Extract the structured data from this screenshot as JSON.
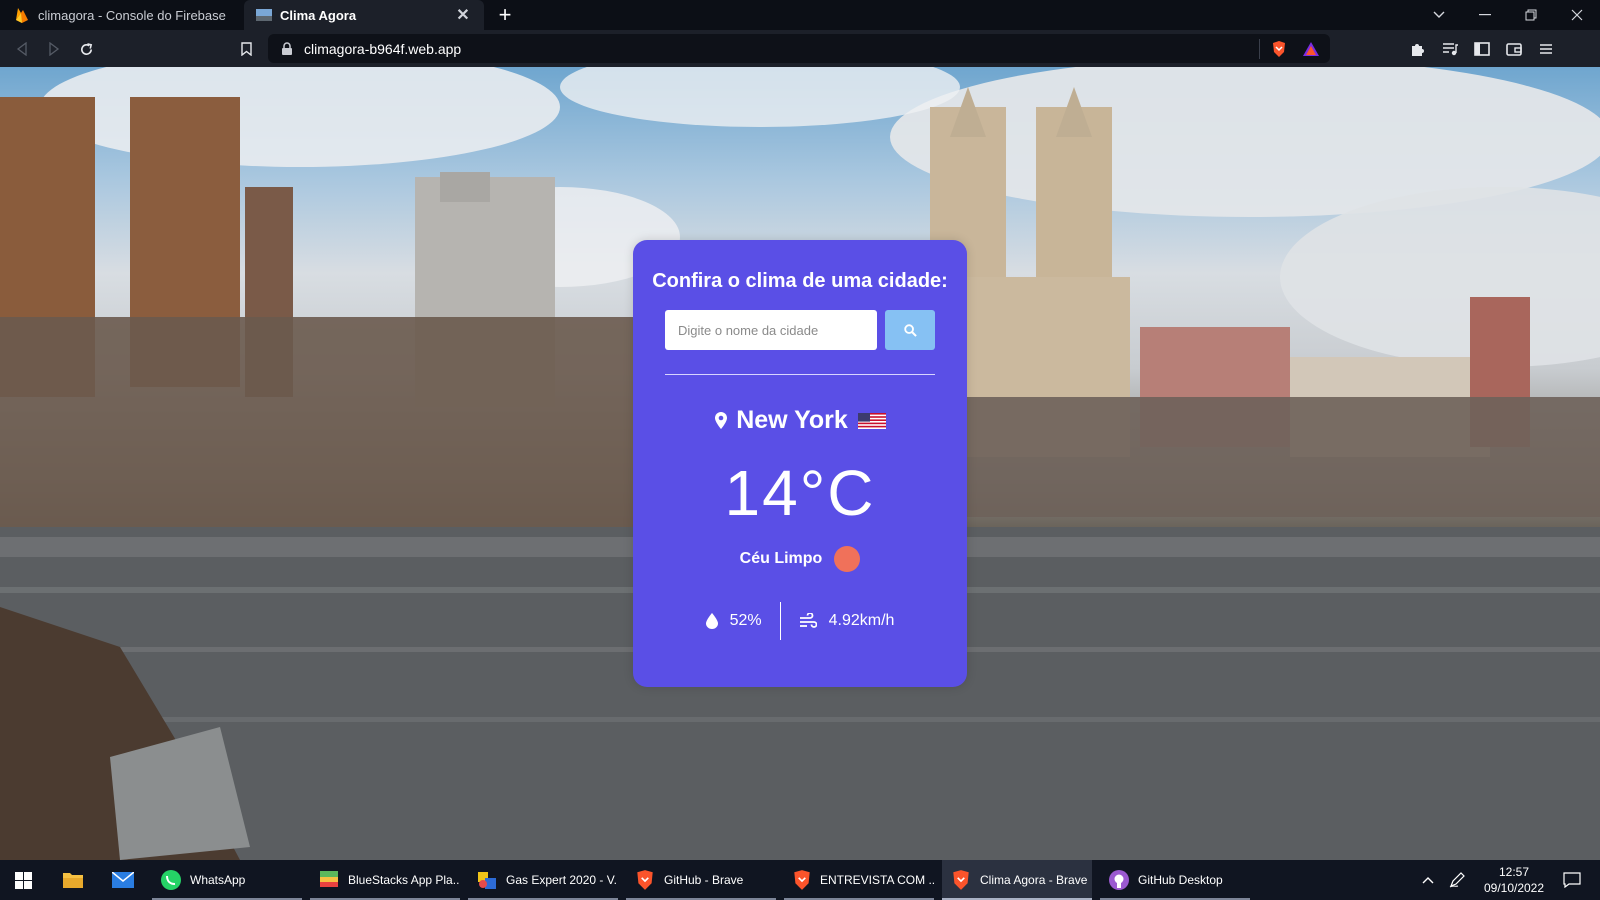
{
  "browser": {
    "tabs": [
      {
        "title": "climagora - Console do Firebase",
        "active": false,
        "icon": "firebase-icon"
      },
      {
        "title": "Clima Agora",
        "active": true,
        "icon": "site-favicon"
      }
    ],
    "url": "climagora-b964f.web.app"
  },
  "app": {
    "heading": "Confira o clima de uma cidade:",
    "search_placeholder": "Digite o nome da cidade",
    "city": "New York",
    "country_flag": "us-flag",
    "temperature": "14",
    "unit": "°C",
    "description": "Céu Limpo",
    "humidity": "52%",
    "wind": "4.92km/h",
    "colors": {
      "card": "#5a4fe6",
      "search_button": "#86c1f3",
      "weather_icon": "#f0715a"
    }
  },
  "taskbar": {
    "items": [
      {
        "label": "WhatsApp",
        "icon": "whatsapp-icon"
      },
      {
        "label": "BlueStacks App Pla...",
        "icon": "bluestacks-icon"
      },
      {
        "label": "Gas Expert 2020 - V...",
        "icon": "gas-expert-icon"
      },
      {
        "label": "GitHub - Brave",
        "icon": "brave-icon"
      },
      {
        "label": "ENTREVISTA COM ...",
        "icon": "brave-icon"
      },
      {
        "label": "Clima Agora - Brave",
        "icon": "brave-icon",
        "active": true
      },
      {
        "label": "GitHub Desktop",
        "icon": "github-desktop-icon"
      }
    ],
    "time": "12:57",
    "date": "09/10/2022"
  }
}
